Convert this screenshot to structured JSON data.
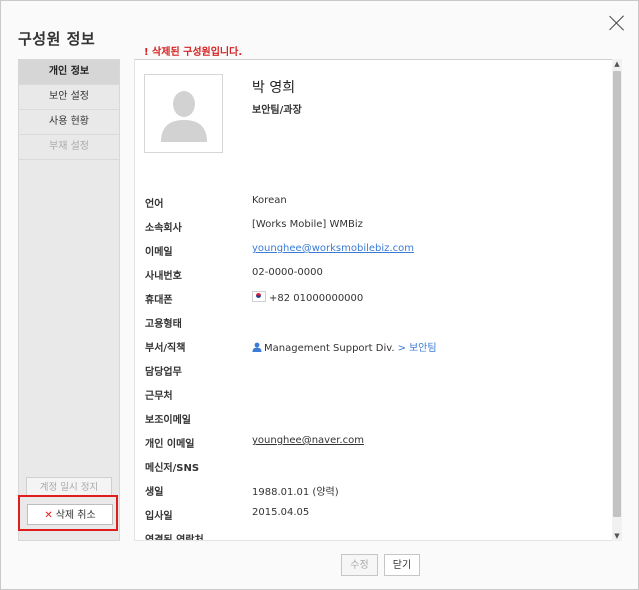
{
  "dialog": {
    "title": "구성원 정보"
  },
  "sidebar": {
    "items": [
      {
        "label": "개인 정보"
      },
      {
        "label": "보안 설정"
      },
      {
        "label": "사용 현황"
      },
      {
        "label": "부재 설정"
      }
    ],
    "suspend_label": "계정 일시 정지",
    "undelete_label": "삭제 취소"
  },
  "notice": "! 삭제된 구성원입니다.",
  "profile": {
    "name": "박 영희",
    "position": "보안팀/과장"
  },
  "fields": {
    "language": {
      "label": "언어",
      "value": "Korean"
    },
    "company": {
      "label": "소속회사",
      "value": "[Works Mobile] WMBiz"
    },
    "email": {
      "label": "이메일",
      "value": "younghee@worksmobilebiz.com"
    },
    "extension": {
      "label": "사내번호",
      "value": "02-0000-0000"
    },
    "mobile": {
      "label": "휴대폰",
      "value": "+82 01000000000"
    },
    "employment": {
      "label": "고용형태",
      "value": ""
    },
    "department": {
      "label": "부서/직책",
      "parent": "Management Support Div.",
      "child": "보안팀"
    },
    "duty": {
      "label": "담당업무",
      "value": ""
    },
    "workplace": {
      "label": "근무처",
      "value": ""
    },
    "secondary_email": {
      "label": "보조이메일",
      "value": ""
    },
    "personal_email": {
      "label": "개인 이메일",
      "value": "younghee@naver.com"
    },
    "messenger": {
      "label": "메신저/SNS",
      "value": ""
    },
    "birthday": {
      "label": "생일",
      "value": "1988.01.01 (양력)"
    },
    "hire_date": {
      "label": "입사일",
      "value": "2015.04.05"
    },
    "linked_contacts": {
      "label": "연결된 연락처",
      "value": ""
    }
  },
  "footer": {
    "edit_label": "수정",
    "close_label": "닫기"
  },
  "icons": {
    "close": "close-icon",
    "avatar": "person-silhouette-icon",
    "flag": "korea-flag-icon",
    "department": "person-icon",
    "delete": "x-icon"
  },
  "colors": {
    "accent_link": "#3a7bd5",
    "alert_red": "#d62020"
  }
}
